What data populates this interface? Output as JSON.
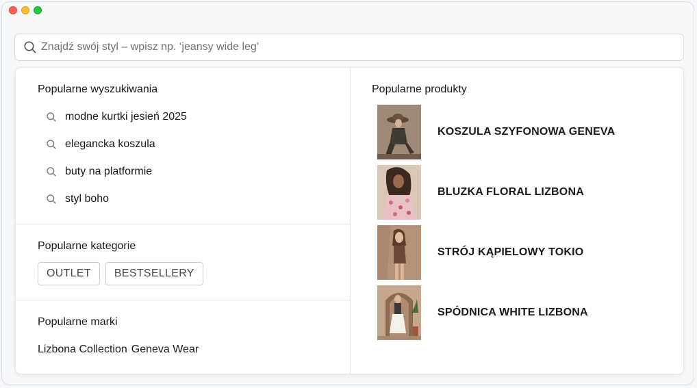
{
  "search": {
    "placeholder": "Znajdź swój styl – wpisz np. ‘jeansy wide leg’",
    "value": ""
  },
  "popular_searches": {
    "title": "Popularne wyszukiwania",
    "items": [
      "modne kurtki jesień 2025",
      "elegancka koszula",
      "buty na platformie",
      "styl boho"
    ]
  },
  "popular_categories": {
    "title": "Popularne kategorie",
    "items": [
      "OUTLET",
      "BESTSELLERY"
    ]
  },
  "popular_brands": {
    "title": "Popularne marki",
    "items": [
      "Lizbona Collection",
      "Geneva Wear"
    ]
  },
  "popular_products": {
    "title": "Popularne produkty",
    "items": [
      {
        "name": "KOSZULA SZYFONOWA GENEVA",
        "image": "woman-in-hat-photo"
      },
      {
        "name": "BLUZKA FLORAL LIZBONA",
        "image": "woman-floral-blouse-photo"
      },
      {
        "name": "STRÓJ KĄPIELOWY TOKIO",
        "image": "woman-swimsuit-photo"
      },
      {
        "name": "SPÓDNICA WHITE LIZBONA",
        "image": "woman-white-skirt-photo"
      }
    ]
  },
  "colors": {
    "window_close": "#ff5f57",
    "window_minimize": "#febc2e",
    "window_maximize": "#28c840"
  }
}
